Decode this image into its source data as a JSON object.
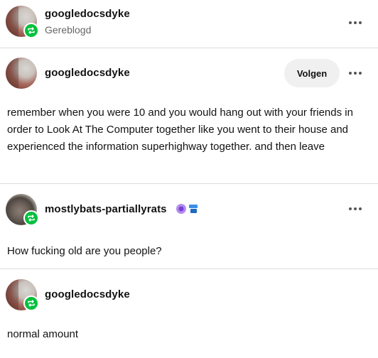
{
  "header": {
    "username": "googledocsdyke",
    "subline": "Gereblogd",
    "more_icon": "more-horizontal-icon"
  },
  "thread": [
    {
      "username": "googledocsdyke",
      "follow_label": "Volgen",
      "text": "remember when you were 10 and you would hang out with your friends in order to Look At The Computer together like you went to their house and experienced the information superhighway together. and then leave"
    },
    {
      "username": "mostlybats-partiallyrats",
      "badges": [
        "purple-badge-icon",
        "blue-badge-icon"
      ],
      "text": "How fucking old are you people?"
    },
    {
      "username": "googledocsdyke",
      "text": "normal amount"
    }
  ],
  "colors": {
    "reblog_green": "#00c03c",
    "follow_bg": "#f0f0f0",
    "divider": "#dcdcdc"
  }
}
